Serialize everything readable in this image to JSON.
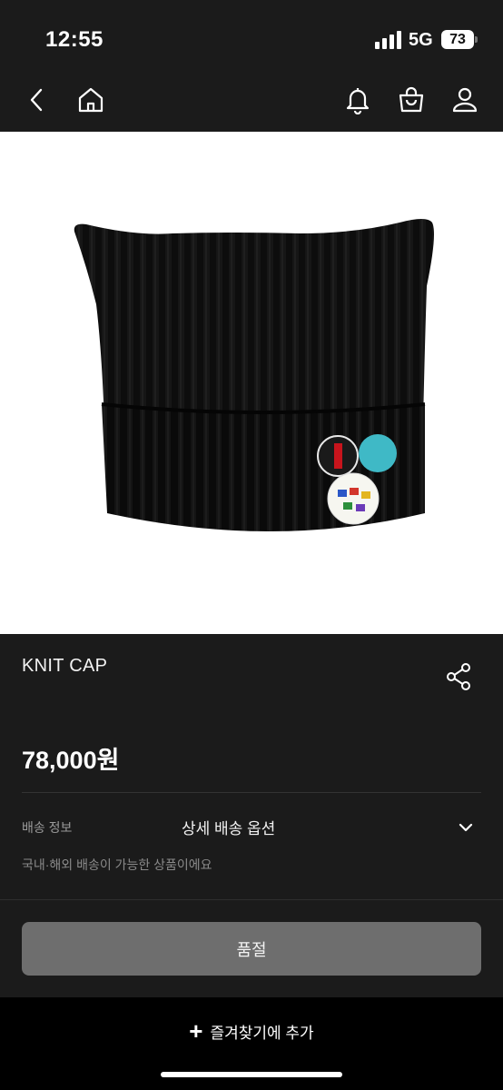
{
  "status_bar": {
    "time": "12:55",
    "network": "5G",
    "battery": "73",
    "battery_level": 0.73
  },
  "nav": {
    "back_icon": "chevron-left-icon",
    "home_icon": "home-icon",
    "notification_icon": "bell-icon",
    "cart_icon": "shopping-bag-icon",
    "profile_icon": "user-icon"
  },
  "product": {
    "name": "KNIT CAP",
    "price": "78,000원",
    "share_icon": "share-icon"
  },
  "shipping": {
    "label": "배송 정보",
    "option": "상세 배송 옵션",
    "note": "국내·해외 배송이 가능한 상품이에요"
  },
  "actions": {
    "soldout_label": "품절",
    "favorite_label": "즐겨찾기에 추가"
  },
  "colors": {
    "background": "#1b1b1b",
    "button_disabled": "#6e6e6e",
    "bottom_bar": "#000000"
  }
}
